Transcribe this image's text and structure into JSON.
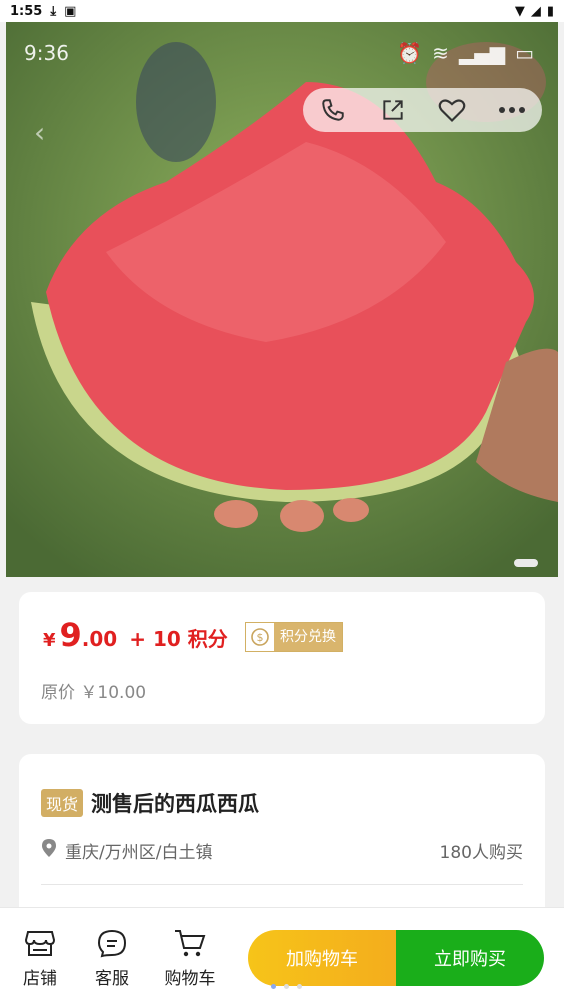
{
  "status_bar": {
    "time": "1:55"
  },
  "hero": {
    "inner_time": "9:36"
  },
  "price": {
    "currency": "¥",
    "integer": "9",
    "decimal": ".00",
    "plus_points": "+ 10 积分",
    "exchange_label": "积分兑换",
    "original": "原价 ￥10.00"
  },
  "product": {
    "tag": "现货",
    "name": "测售后的西瓜西瓜",
    "location": "重庆/万州区/白土镇",
    "sold": "180人购买"
  },
  "bottom": {
    "shop": "店铺",
    "service": "客服",
    "cart": "购物车",
    "add_cart": "加购物车",
    "buy_now": "立即购买"
  },
  "colors": {
    "price_red": "#e02020",
    "gold": "#d2ae64",
    "green": "#1aae1a",
    "yellow": "#f6c419"
  }
}
